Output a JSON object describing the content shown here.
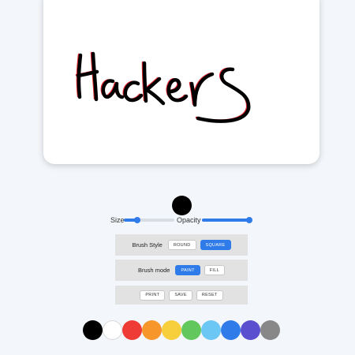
{
  "canvas": {
    "drawing_text": "Hackers",
    "stroke_color": "#000000",
    "shadow_color": "#e0262e"
  },
  "brush": {
    "preview_color": "#000000",
    "size_label": "Size",
    "size_value": 0.25,
    "opacity_label": "Opacity",
    "opacity_value": 1.0
  },
  "brush_style": {
    "label": "Brush Style",
    "options": [
      "ROUND",
      "SQUARE"
    ],
    "selected": "SQUARE"
  },
  "brush_mode": {
    "label": "Brush mode",
    "options": [
      "PAINT",
      "FILL"
    ],
    "selected": "PAINT"
  },
  "actions": {
    "print": "PRINT",
    "save": "SAVE",
    "reset": "RESET"
  },
  "palette": {
    "colors": [
      "#000000",
      "#ffffff",
      "#ef3b36",
      "#f7962a",
      "#f7cf3c",
      "#62c85d",
      "#6cc7f5",
      "#2f7bea",
      "#5a4fcf",
      "#888888"
    ],
    "names": [
      "black",
      "white",
      "red",
      "orange",
      "yellow",
      "green",
      "light-blue",
      "blue",
      "purple",
      "gray"
    ]
  },
  "accent": "#2f7bea"
}
